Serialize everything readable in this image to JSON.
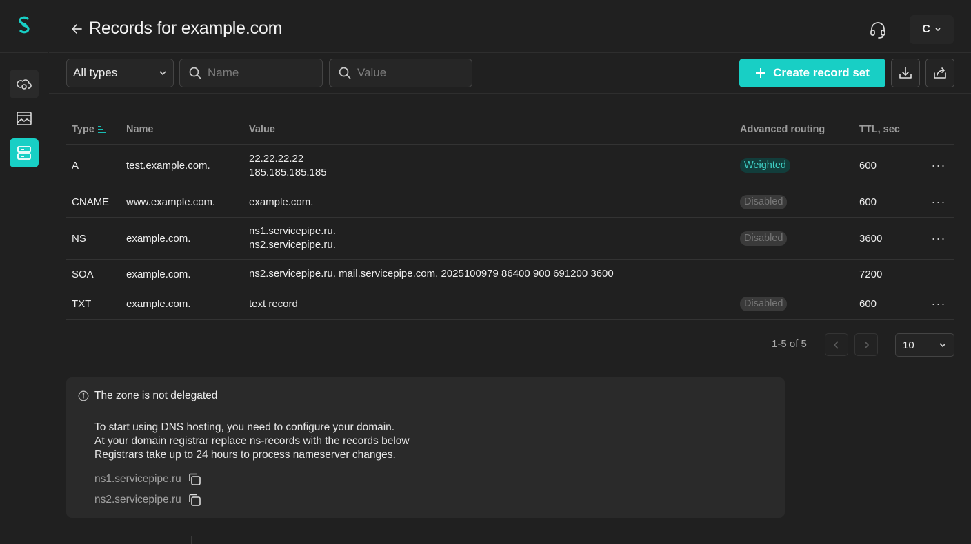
{
  "header": {
    "title": "Records for example.com",
    "account_initial": "C"
  },
  "sidebar": {
    "items": [
      {
        "icon": "cloud-network-icon"
      },
      {
        "icon": "image-frame-icon"
      },
      {
        "icon": "server-icon",
        "active": true
      }
    ]
  },
  "toolbar": {
    "type_filter": "All types",
    "name_placeholder": "Name",
    "value_placeholder": "Value",
    "create_label": "Create record set"
  },
  "table": {
    "columns": {
      "type": "Type",
      "name": "Name",
      "value": "Value",
      "advanced": "Advanced routing",
      "ttl": "TTL, sec"
    },
    "rows": [
      {
        "type": "A",
        "name": "test.example.com.",
        "value1": "22.22.22.22",
        "value2": "185.185.185.185",
        "routing": "Weighted",
        "ttl": "600"
      },
      {
        "type": "CNAME",
        "name": "www.example.com.",
        "value1": "example.com.",
        "value2": "",
        "routing": "Disabled",
        "ttl": "600"
      },
      {
        "type": "NS",
        "name": "example.com.",
        "value1": "ns1.servicepipe.ru.",
        "value2": "ns2.servicepipe.ru.",
        "routing": "Disabled",
        "ttl": "3600"
      },
      {
        "type": "SOA",
        "name": "example.com.",
        "value1": "ns2.servicepipe.ru. mail.servicepipe.com. 2025100979 86400 900 691200 3600",
        "value2": "",
        "routing": "",
        "ttl": "7200"
      },
      {
        "type": "TXT",
        "name": "example.com.",
        "value1": "text record",
        "value2": "",
        "routing": "Disabled",
        "ttl": "600"
      }
    ]
  },
  "pagination": {
    "range": "1-5 of 5",
    "page_size": "10"
  },
  "notice": {
    "title": "The zone is not delegated",
    "line1": "To start using DNS hosting, you need to configure your domain.",
    "line2": "At your domain registrar replace ns-records with the records below",
    "line3": "Registrars take up to 24 hours to process nameserver changes.",
    "ns1": "ns1.servicepipe.ru",
    "ns2": "ns2.servicepipe.ru"
  },
  "colors": {
    "accent": "#18cfc5",
    "background": "#202020"
  }
}
